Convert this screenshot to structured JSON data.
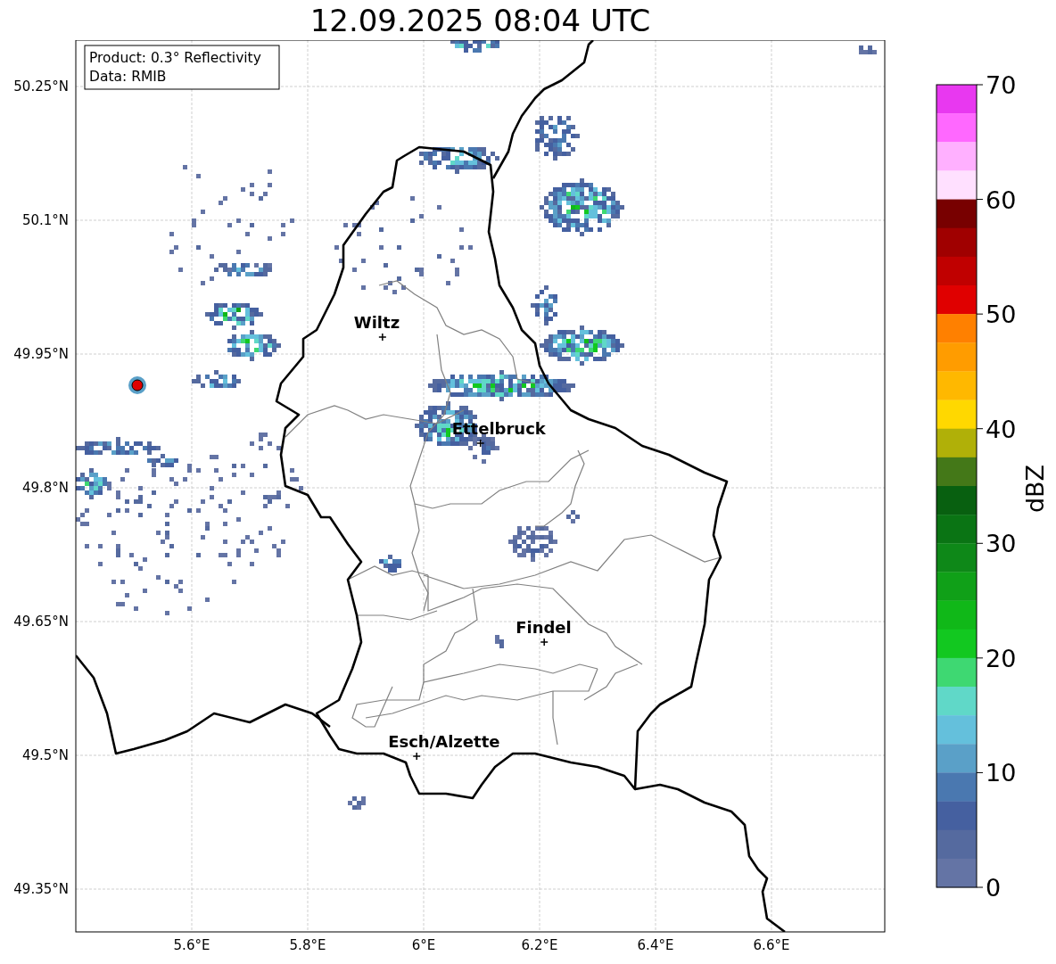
{
  "title": "12.09.2025 08:04 UTC",
  "info_box": {
    "product": "Product: 0.3° Reflectivity",
    "data": "Data: RMIB"
  },
  "map": {
    "xticks": [
      "5.6°E",
      "5.8°E",
      "6°E",
      "6.2°E",
      "6.4°E",
      "6.6°E"
    ],
    "yticks": [
      "50.25°N",
      "50.1°N",
      "49.95°N",
      "49.8°N",
      "49.65°N",
      "49.5°N",
      "49.35°N"
    ],
    "cities": [
      {
        "name": "Wiltz"
      },
      {
        "name": "Ettelbruck"
      },
      {
        "name": "Findel"
      },
      {
        "name": "Esch/Alzette"
      }
    ]
  },
  "colorbar": {
    "label": "dBZ",
    "ticks": [
      "70",
      "60",
      "50",
      "40",
      "30",
      "20",
      "10",
      "0"
    ],
    "segments": [
      {
        "color": "#e838f0"
      },
      {
        "color": "#ff68ff"
      },
      {
        "color": "#ffb0ff"
      },
      {
        "color": "#ffe0ff"
      },
      {
        "color": "#780000"
      },
      {
        "color": "#a00000"
      },
      {
        "color": "#c00000"
      },
      {
        "color": "#e00000"
      },
      {
        "color": "#ff8000"
      },
      {
        "color": "#ff9c00"
      },
      {
        "color": "#ffb800"
      },
      {
        "color": "#ffd800"
      },
      {
        "color": "#b0b008"
      },
      {
        "color": "#447818"
      },
      {
        "color": "#086010"
      },
      {
        "color": "#0a7414"
      },
      {
        "color": "#0e8818"
      },
      {
        "color": "#10a018"
      },
      {
        "color": "#10b818"
      },
      {
        "color": "#12c820"
      },
      {
        "color": "#3ed872"
      },
      {
        "color": "#60d8c8"
      },
      {
        "color": "#64c0dc"
      },
      {
        "color": "#5aa0c8"
      },
      {
        "color": "#4a78b0"
      },
      {
        "color": "#4560a0"
      },
      {
        "color": "#556a9f"
      },
      {
        "color": "#6474a5"
      }
    ]
  }
}
